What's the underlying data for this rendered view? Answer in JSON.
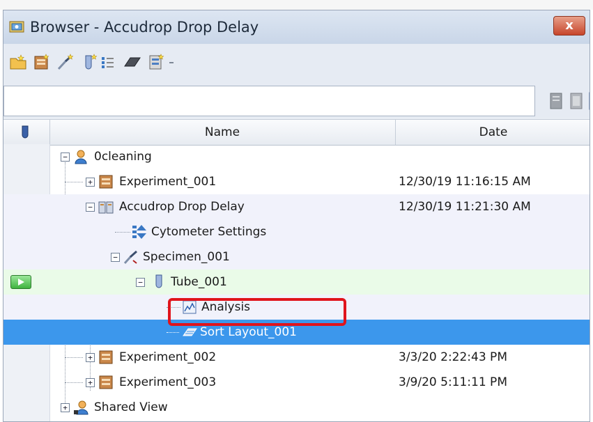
{
  "window": {
    "title": "Browser - Accudrop Drop Delay",
    "close_label": "x"
  },
  "toolbar": {
    "icons": [
      "new-folder-icon",
      "new-experiment-icon",
      "new-specimen-icon",
      "new-tube-icon",
      "new-keywords-icon",
      "eraser-icon",
      "new-sort-layout-icon",
      "more-icon"
    ]
  },
  "search": {
    "value": "",
    "placeholder": ""
  },
  "grid": {
    "columns": {
      "name": "Name",
      "date": "Date"
    },
    "rows": [
      {
        "label": "0cleaning",
        "date": "",
        "icon": "user-folder-icon"
      },
      {
        "label": "Experiment_001",
        "date": "12/30/19 11:16:15 AM",
        "icon": "experiment-icon"
      },
      {
        "label": "Accudrop Drop Delay",
        "date": "12/30/19 11:21:30 AM",
        "icon": "open-experiment-icon"
      },
      {
        "label": "Cytometer Settings",
        "date": "",
        "icon": "cytometer-settings-icon"
      },
      {
        "label": "Specimen_001",
        "date": "",
        "icon": "specimen-icon"
      },
      {
        "label": "Tube_001",
        "date": "",
        "icon": "tube-icon"
      },
      {
        "label": "Analysis",
        "date": "",
        "icon": "analysis-icon"
      },
      {
        "label": "Sort Layout_001",
        "date": "",
        "icon": "sort-layout-icon"
      },
      {
        "label": "Experiment_002",
        "date": "3/3/20 2:22:43 PM",
        "icon": "experiment-icon"
      },
      {
        "label": "Experiment_003",
        "date": "3/9/20 5:11:11 PM",
        "icon": "experiment-icon"
      },
      {
        "label": "Shared View",
        "date": "",
        "icon": "shared-view-icon"
      }
    ]
  },
  "colors": {
    "selection": "#3c97ec",
    "current_tube_row": "#eafbe8",
    "highlight_box": "#e0141c"
  }
}
